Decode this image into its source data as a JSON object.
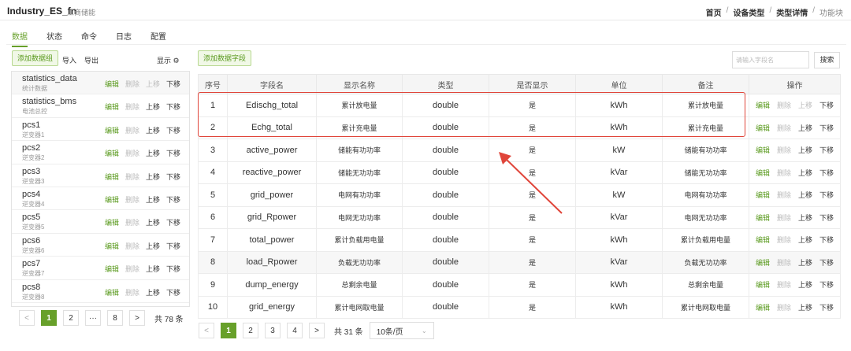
{
  "header": {
    "title": "Industry_ES_fn",
    "subtitle": "工商储能",
    "breadcrumb": [
      "首页",
      "设备类型",
      "类型详情",
      "功能块"
    ]
  },
  "tabs": [
    "数据",
    "状态",
    "命令",
    "日志",
    "配置"
  ],
  "left": {
    "add_group_label": "添加数据组",
    "import_label": "导入",
    "export_label": "导出",
    "display_label": "显示 ⚙",
    "groups": [
      {
        "name": "statistics_data",
        "sub": "统计数据"
      },
      {
        "name": "statistics_bms",
        "sub": "电池总控"
      },
      {
        "name": "pcs1",
        "sub": "逆变器1"
      },
      {
        "name": "pcs2",
        "sub": "逆变器2"
      },
      {
        "name": "pcs3",
        "sub": "逆变器3"
      },
      {
        "name": "pcs4",
        "sub": "逆变器4"
      },
      {
        "name": "pcs5",
        "sub": "逆变器5"
      },
      {
        "name": "pcs6",
        "sub": "逆变器6"
      },
      {
        "name": "pcs7",
        "sub": "逆变器7"
      },
      {
        "name": "pcs8",
        "sub": "逆变器8"
      }
    ],
    "actions": {
      "edit": "编辑",
      "delete": "删除",
      "up": "上移",
      "down": "下移"
    },
    "pager": {
      "prev": "<",
      "pages": [
        "1",
        "2",
        "···",
        "8"
      ],
      "next": ">",
      "total": "共 78 条"
    }
  },
  "right": {
    "add_field_label": "添加数据字段",
    "search_placeholder": "请输入字段名",
    "search_label": "搜索",
    "columns": [
      "序号",
      "字段名",
      "显示名称",
      "类型",
      "是否显示",
      "单位",
      "备注",
      "操作"
    ],
    "rows": [
      {
        "idx": "1",
        "field": "Edischg_total",
        "display": "累计放电量",
        "type": "double",
        "show": "是",
        "unit": "kWh",
        "note": "累计放电量"
      },
      {
        "idx": "2",
        "field": "Echg_total",
        "display": "累计充电量",
        "type": "double",
        "show": "是",
        "unit": "kWh",
        "note": "累计充电量"
      },
      {
        "idx": "3",
        "field": "active_power",
        "display": "储能有功功率",
        "type": "double",
        "show": "是",
        "unit": "kW",
        "note": "储能有功功率"
      },
      {
        "idx": "4",
        "field": "reactive_power",
        "display": "储能无功功率",
        "type": "double",
        "show": "是",
        "unit": "kVar",
        "note": "储能无功功率"
      },
      {
        "idx": "5",
        "field": "grid_power",
        "display": "电网有功功率",
        "type": "double",
        "show": "是",
        "unit": "kW",
        "note": "电网有功功率"
      },
      {
        "idx": "6",
        "field": "grid_Rpower",
        "display": "电网无功功率",
        "type": "double",
        "show": "是",
        "unit": "kVar",
        "note": "电网无功功率"
      },
      {
        "idx": "7",
        "field": "total_power",
        "display": "累计负载用电量",
        "type": "double",
        "show": "是",
        "unit": "kWh",
        "note": "累计负载用电量"
      },
      {
        "idx": "8",
        "field": "load_Rpower",
        "display": "负载无功功率",
        "type": "double",
        "show": "是",
        "unit": "kVar",
        "note": "负载无功功率"
      },
      {
        "idx": "9",
        "field": "dump_energy",
        "display": "总剩余电量",
        "type": "double",
        "show": "是",
        "unit": "kWh",
        "note": "总剩余电量"
      },
      {
        "idx": "10",
        "field": "grid_energy",
        "display": "累计电网取电量",
        "type": "double",
        "show": "是",
        "unit": "kWh",
        "note": "累计电网取电量"
      }
    ],
    "actions": {
      "edit": "编辑",
      "delete": "删除",
      "up": "上移",
      "down": "下移"
    },
    "pager": {
      "prev": "<",
      "pages": [
        "1",
        "2",
        "3",
        "4"
      ],
      "next": ">",
      "total": "共 31 条",
      "page_size": "10条/页"
    }
  },
  "colors": {
    "accent": "#67a02a",
    "highlight": "#e0453a"
  }
}
